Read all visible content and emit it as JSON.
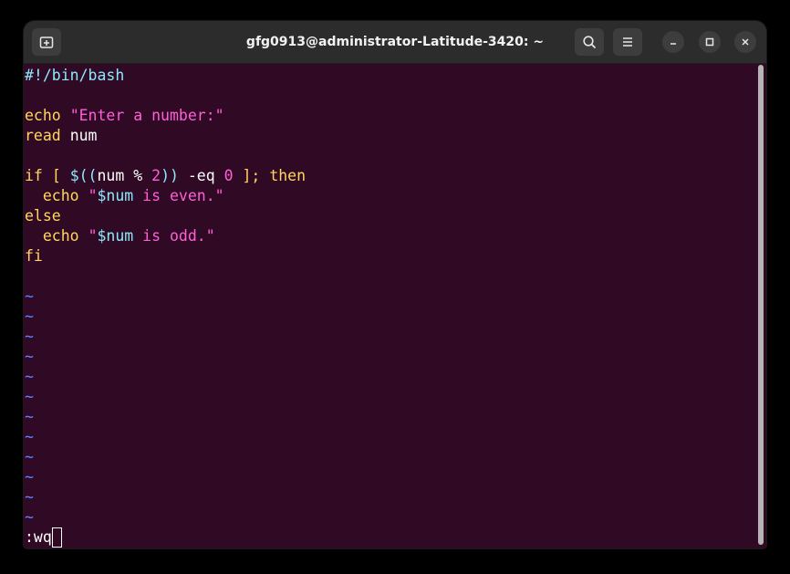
{
  "window": {
    "title": "gfg0913@administrator-Latitude-3420: ~"
  },
  "colors": {
    "background": "#300a24",
    "titlebar": "#2c2c2c",
    "shebang": "#8be9fd",
    "keyword": "#ffd75f",
    "string": "#ff5fd7",
    "tilde": "#5f87ff"
  },
  "icons": {
    "new_tab": "new-tab-icon",
    "search": "search-icon",
    "menu": "hamburger-menu-icon",
    "minimize": "minimize-icon",
    "maximize": "maximize-icon",
    "close": "close-icon"
  },
  "code": {
    "l1": "#!/bin/bash",
    "l3_kw": "echo",
    "l3_str": "\"Enter a number:\"",
    "l4_kw": "read",
    "l4_rest": "num",
    "l6_if": "if",
    "l6_br1": "[",
    "l6_dollar": "$((",
    "l6_num": "num",
    "l6_pct": "%",
    "l6_two": "2",
    "l6_close": "))",
    "l6_eq": "-eq",
    "l6_zero": "0",
    "l6_br2": "];",
    "l6_then": "then",
    "l7_kw": "echo",
    "l7_q": "\"",
    "l7_var": "$num",
    "l7_str": " is even.\"",
    "l8_kw": "else",
    "l9_kw": "echo",
    "l9_q": "\"",
    "l9_var": "$num",
    "l9_str": " is odd.\"",
    "l10_kw": "fi"
  },
  "empty_line_marker": "~",
  "command_line": ":wq"
}
